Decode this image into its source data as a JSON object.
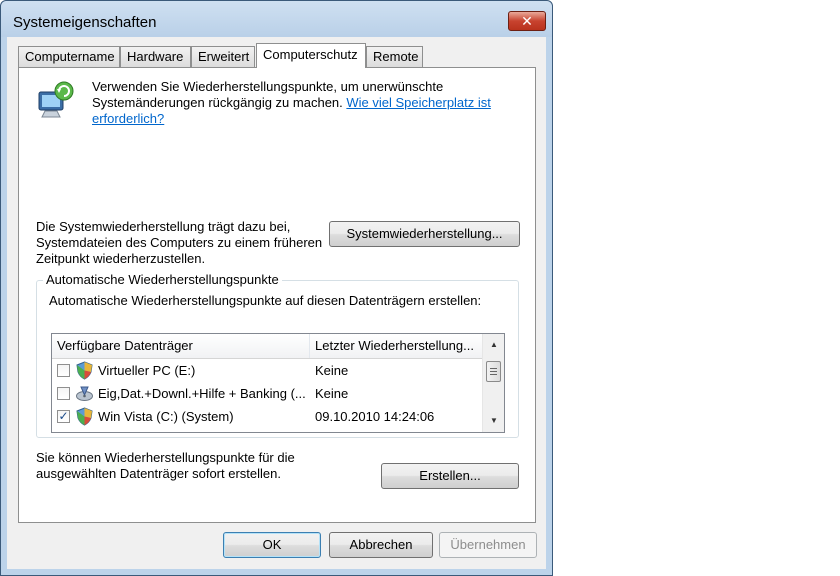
{
  "window": {
    "title": "Systemeigenschaften",
    "close_glyph": "✕"
  },
  "tabs": [
    {
      "label": "Computername",
      "active": false
    },
    {
      "label": "Hardware",
      "active": false
    },
    {
      "label": "Erweitert",
      "active": false
    },
    {
      "label": "Computerschutz",
      "active": true
    },
    {
      "label": "Remote",
      "active": false
    }
  ],
  "protection": {
    "intro_text": "Verwenden Sie Wiederherstellungspunkte, um unerwünschte Systemänderungen rückgängig zu machen.",
    "intro_link": "Wie viel Speicherplatz ist erforderlich?",
    "system_restore_text": "Die Systemwiederherstellung trägt dazu bei, Systemdateien des Computers zu einem früheren Zeitpunkt wiederherzustellen.",
    "system_restore_button": "Systemwiederherstellung...",
    "group_title": "Automatische Wiederherstellungspunkte",
    "group_description": "Automatische Wiederherstellungspunkte auf diesen Datenträgern erstellen:",
    "list_headers": {
      "drives": "Verfügbare Datenträger",
      "last_restore": "Letzter Wiederherstellung..."
    },
    "drives": [
      {
        "name": "Virtueller PC (E:)",
        "last_restore": "Keine",
        "checked": false,
        "icon": "shield-drive-icon"
      },
      {
        "name": "Eig,Dat.+Downl.+Hilfe + Banking (...",
        "last_restore": "Keine",
        "checked": false,
        "icon": "drive-icon"
      },
      {
        "name": "Win Vista (C:) (System)",
        "last_restore": "09.10.2010 14:24:06",
        "checked": true,
        "icon": "shield-drive-icon"
      }
    ],
    "create_text": "Sie können Wiederherstellungspunkte für die ausgewählten Datenträger sofort erstellen.",
    "create_button": "Erstellen..."
  },
  "buttons": {
    "ok": "OK",
    "cancel": "Abbrechen",
    "apply": "Übernehmen"
  },
  "colors": {
    "link": "#0066cc",
    "title_bar": "#bcd3ea",
    "close_button": "#c8432f"
  }
}
